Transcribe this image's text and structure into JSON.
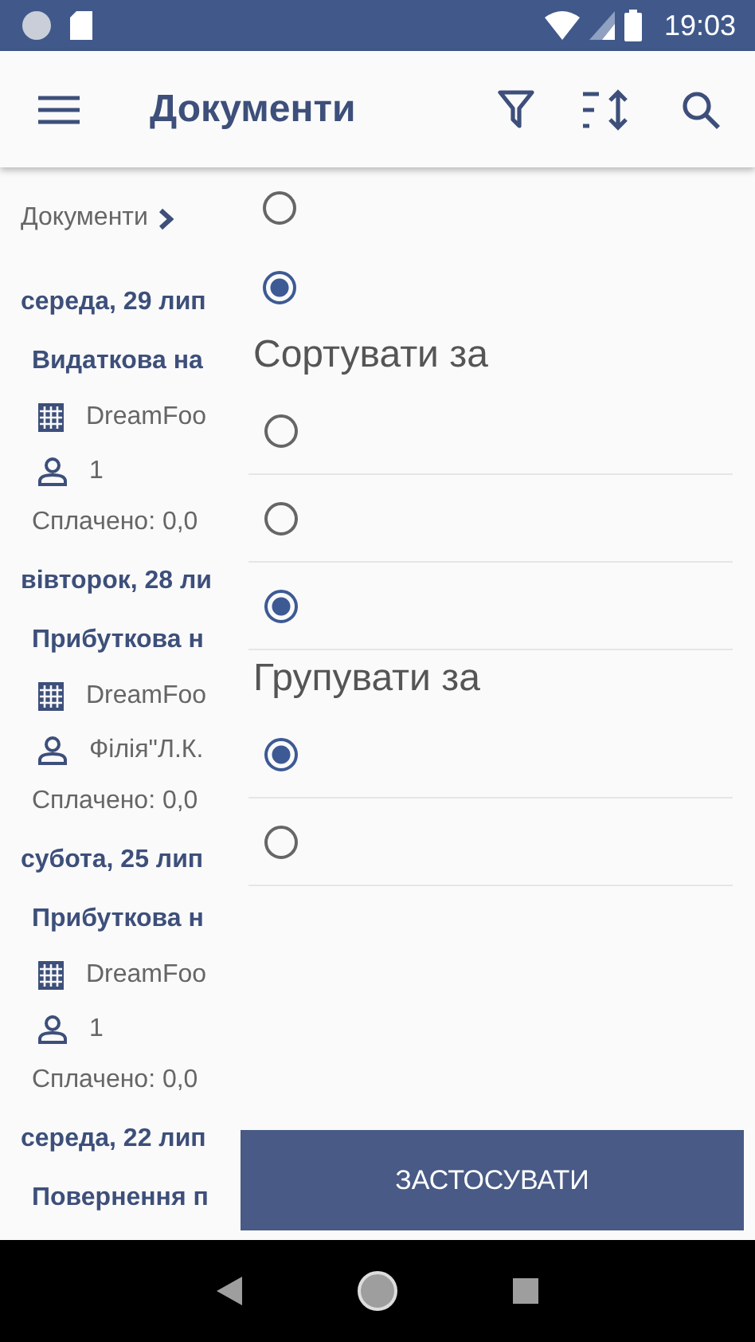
{
  "status_bar": {
    "time": "19:03"
  },
  "app_bar": {
    "title": "Документи"
  },
  "breadcrumb": {
    "label": "Документи"
  },
  "groups": [
    {
      "date": "середа, 29 лип",
      "documents": [
        {
          "title": "Видаткова на",
          "company": "DreamFoo",
          "person": "1",
          "paid": "Сплачено: 0,0"
        }
      ]
    },
    {
      "date": "вівторок, 28 ли",
      "documents": [
        {
          "title": "Прибуткова н",
          "company": "DreamFoo",
          "person": "Філія\"Л.К.",
          "paid": "Сплачено: 0,0"
        }
      ]
    },
    {
      "date": "субота, 25 лип",
      "documents": [
        {
          "title": "Прибуткова н",
          "company": "DreamFoo",
          "person": "1",
          "paid": "Сплачено: 0,0"
        }
      ]
    },
    {
      "date": "середа, 22 лип",
      "documents": [
        {
          "title": "Повернення п"
        }
      ]
    }
  ],
  "filter_panel": {
    "sections": [
      {
        "options": [
          {
            "selected": false,
            "divider": false
          },
          {
            "selected": true,
            "divider": false
          }
        ]
      },
      {
        "title": "Сортувати за",
        "options": [
          {
            "selected": false,
            "divider": true
          },
          {
            "selected": false,
            "divider": true
          },
          {
            "selected": true,
            "divider": true
          }
        ]
      },
      {
        "title": "Групувати за",
        "options": [
          {
            "selected": true,
            "divider": true
          },
          {
            "selected": false,
            "divider": true
          }
        ]
      }
    ],
    "apply_button": "ЗАСТОСУВАТИ"
  }
}
